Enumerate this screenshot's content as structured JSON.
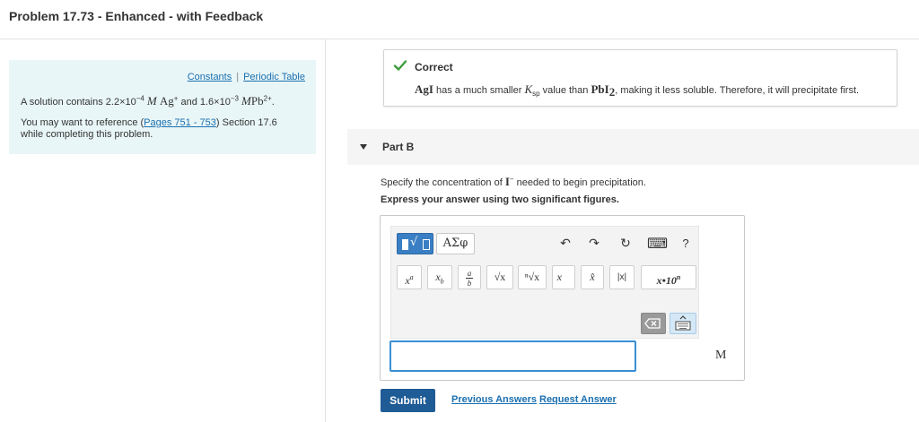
{
  "page": {
    "title": "Problem 17.73 - Enhanced - with Feedback"
  },
  "info_panel": {
    "links": [
      "Constants",
      "Periodic Table"
    ],
    "separator": "|",
    "statement": {
      "prefix": "A solution contains 2.2×10",
      "exp1": "−4",
      "unit1": "M",
      "ion1": "Ag",
      "ion1_charge": "+",
      "mid": "and 1.6×10",
      "exp2": "−3",
      "unit2": "M",
      "ion2": "Pb",
      "ion2_charge": "2+",
      "suffix": "."
    },
    "reference": {
      "before": "You may want to reference (",
      "link": "Pages 751 - 753",
      "after": ") Section 17.6",
      "line2": "while completing this problem."
    }
  },
  "feedback": {
    "status": "Correct",
    "chem1": "AgI",
    "text1": "has a much smaller",
    "ksp_symbol": "K",
    "ksp_sub": "sp",
    "text2": "value than",
    "chem2_base": "PbI",
    "chem2_sub": "2",
    "text3": ", making it less soluble. Therefore, it will precipitate first.",
    "icon": "checkmark-icon",
    "accent": "#3e9b3e"
  },
  "part_b": {
    "label": "Part B",
    "question_prefix": "Specify the concentration of",
    "question_ion": "I",
    "question_charge": "−",
    "question_suffix": "needed to begin precipitation.",
    "instruction": "Express your answer using two significant figures."
  },
  "toolbar": {
    "greek_label": "ΑΣφ",
    "undo_glyph": "↶",
    "redo_glyph": "↷",
    "reset_glyph": "↻",
    "keyboard_glyph": "⌨",
    "help_label": "?",
    "symbols": {
      "superscript_base": "x",
      "superscript_exp": "a",
      "subscript_base": "x",
      "subscript_sub": "b",
      "frac_num": "a",
      "frac_den": "b",
      "sqrt": "√x",
      "nthroot": "ⁿ√x",
      "vector": "x⃗",
      "hat": "x̂",
      "abs": "|x|",
      "sci_base": "x•10",
      "sci_exp": "n"
    },
    "delete_glyph": "⌫"
  },
  "answer": {
    "value": "",
    "unit": "M"
  },
  "actions": {
    "submit": "Submit",
    "previous_answers": "Previous Answers",
    "request_answer": "Request Answer"
  }
}
